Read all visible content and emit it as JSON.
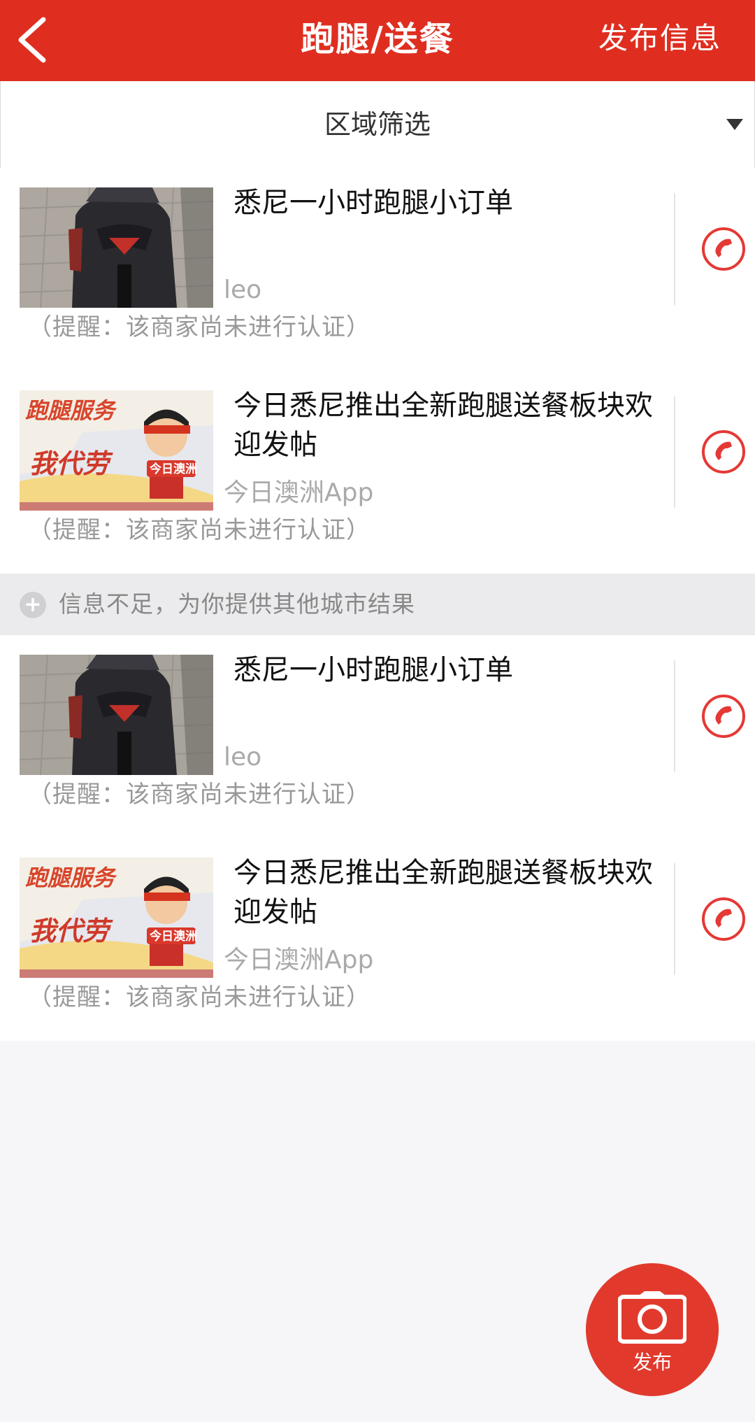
{
  "header": {
    "title": "跑腿/送餐",
    "right_action": "发布信息",
    "back_icon": "chevron-left-icon",
    "color": "#df2e20"
  },
  "filter": {
    "label": "区域筛选",
    "arrow_icon": "triangle-down-icon"
  },
  "list_primary": [
    {
      "title": "悉尼一小时跑腿小订单",
      "author": "leo",
      "note": "（提醒：该商家尚未进行认证）",
      "thumb": "scooter-photo"
    },
    {
      "title": "今日悉尼推出全新跑腿送餐板块欢迎发帖",
      "author": "今日澳洲App",
      "note": "（提醒：该商家尚未进行认证）",
      "thumb": "errand-service-banner",
      "thumb_text": {
        "line1": "跑腿服务",
        "line2": "我代劳",
        "badge": "今日澳洲"
      }
    }
  ],
  "notice": {
    "icon": "plus-circle-icon",
    "text": "信息不足，为你提供其他城市结果"
  },
  "list_other": [
    {
      "title": "悉尼一小时跑腿小订单",
      "author": "leo",
      "note": "（提醒：该商家尚未进行认证）",
      "thumb": "scooter-photo"
    },
    {
      "title": "今日悉尼推出全新跑腿送餐板块欢迎发帖",
      "author": "今日澳洲App",
      "note": "（提醒：该商家尚未进行认证）",
      "thumb": "errand-service-banner",
      "thumb_text": {
        "line1": "跑腿服务",
        "line2": "我代劳",
        "badge": "今日澳洲"
      }
    }
  ],
  "fab": {
    "label": "发布",
    "icon": "camera-icon",
    "color": "#e13a2d"
  },
  "accent": "#e53935"
}
